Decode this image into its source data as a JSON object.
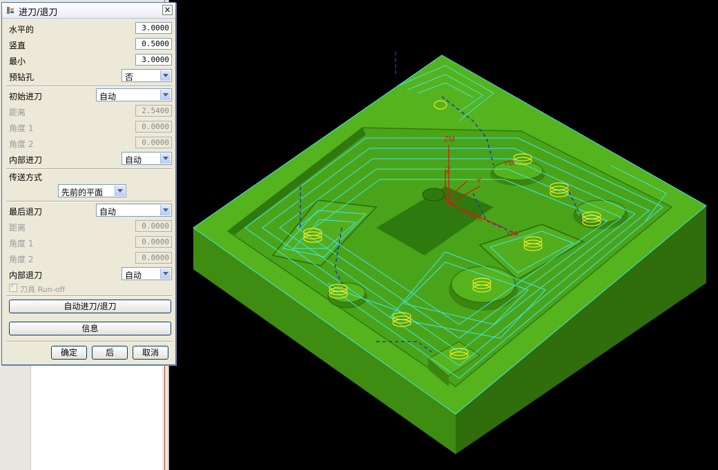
{
  "dialog": {
    "title": "进刀/退刀",
    "close_glyph": "×",
    "horizontal_label": "水平的",
    "horizontal_value": "3.0000",
    "vertical_label": "竖直",
    "vertical_value": "0.5000",
    "min_label": "最小",
    "min_value": "3.0000",
    "predrill_label": "预钻孔",
    "predrill_value": "否",
    "initial_engage_label": "初始进刀",
    "initial_engage_value": "自动",
    "init_distance_label": "距离",
    "init_distance_value": "2.5400",
    "init_angle1_label": "角度 1",
    "init_angle1_value": "0.0000",
    "init_angle2_label": "角度 2",
    "init_angle2_value": "0.0000",
    "internal_engage_label": "内部进刀",
    "internal_engage_value": "自动",
    "transfer_label": "传送方式",
    "transfer_value": "先前的平面",
    "final_retract_label": "最后退刀",
    "final_retract_value": "自动",
    "final_distance_label": "距离",
    "final_distance_value": "0.0000",
    "final_angle1_label": "角度 1",
    "final_angle1_value": "0.0000",
    "final_angle2_label": "角度 2",
    "final_angle2_value": "0.0000",
    "internal_retract_label": "内部退刀",
    "internal_retract_value": "自动",
    "runoff_label": "刀具 Run-off",
    "auto_button": "自动进刀/退刀",
    "info_button": "信息",
    "ok_button": "确定",
    "back_button": "后",
    "cancel_button": "取消"
  },
  "viewport": {
    "axis_zm": "ZM",
    "axis_xm": "XM",
    "axis_ym": "YM",
    "axis_z": "Z",
    "axis_x": "X",
    "axis_y": "Y",
    "colors": {
      "part_top": "#54b21c",
      "part_side_left": "#3f8c12",
      "part_side_right": "#2f6e0a",
      "toolpath": "#3fe8ea",
      "tool": "#f2ee22",
      "axis": "#d81a12",
      "transfer_path": "#1a1aa0"
    }
  }
}
